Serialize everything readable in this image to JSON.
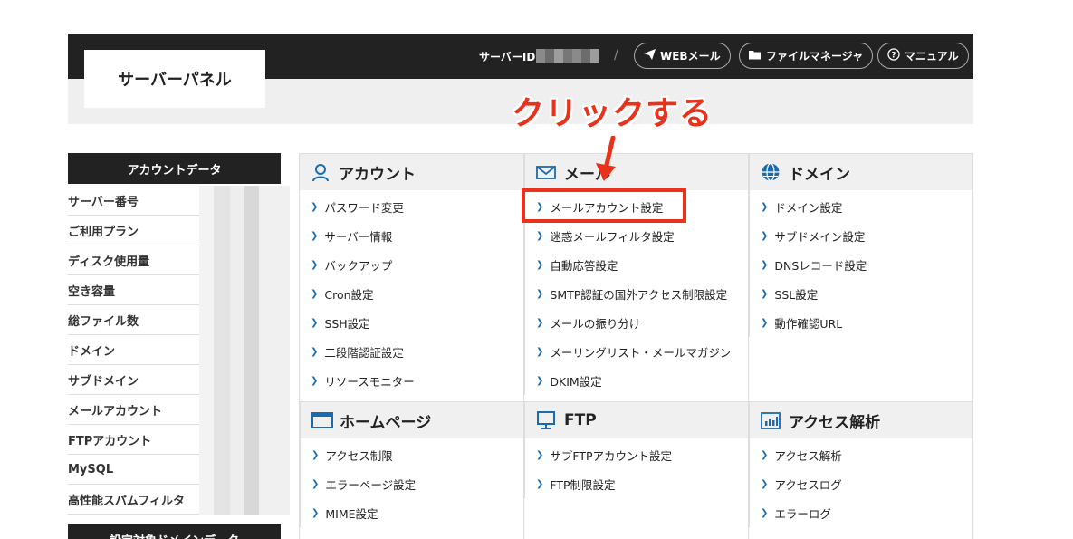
{
  "header": {
    "logo": "サーバーパネル",
    "server_id_label": "サーバーID",
    "separator": "/",
    "buttons": [
      {
        "label": "WEBメール",
        "icon": "paper-plane-icon"
      },
      {
        "label": "ファイルマネージャ",
        "icon": "folder-icon"
      },
      {
        "label": "マニュアル",
        "icon": "help-circle-icon"
      }
    ]
  },
  "annotation": {
    "text": "クリックする",
    "color": "#e8321c"
  },
  "sidebar": {
    "title": "アカウントデータ",
    "items": [
      "サーバー番号",
      "ご利用プラン",
      "ディスク使用量",
      "空き容量",
      "総ファイル数",
      "ドメイン",
      "サブドメイン",
      "メールアカウント",
      "FTPアカウント",
      "MySQL",
      "高性能スパムフィルタ"
    ],
    "title2": "設定対象ドメインデータ"
  },
  "sections": {
    "account": {
      "title": "アカウント",
      "icon": "user-icon",
      "items": [
        "パスワード変更",
        "サーバー情報",
        "バックアップ",
        "Cron設定",
        "SSH設定",
        "二段階認証設定",
        "リソースモニター"
      ]
    },
    "mail": {
      "title": "メール",
      "icon": "envelope-icon",
      "items": [
        "メールアカウント設定",
        "迷惑メールフィルタ設定",
        "自動応答設定",
        "SMTP認証の国外アクセス制限設定",
        "メールの振り分け",
        "メーリングリスト・メールマガジン",
        "DKIM設定"
      ]
    },
    "domain": {
      "title": "ドメイン",
      "icon": "globe-icon",
      "items": [
        "ドメイン設定",
        "サブドメイン設定",
        "DNSレコード設定",
        "SSL設定",
        "動作確認URL"
      ]
    },
    "homepage": {
      "title": "ホームページ",
      "icon": "browser-window-icon",
      "items": [
        "アクセス制限",
        "エラーページ設定",
        "MIME設定"
      ]
    },
    "ftp": {
      "title": "FTP",
      "icon": "monitor-icon",
      "items": [
        "サブFTPアカウント設定",
        "FTP制限設定"
      ]
    },
    "analytics": {
      "title": "アクセス解析",
      "icon": "bar-chart-icon",
      "items": [
        "アクセス解析",
        "アクセスログ",
        "エラーログ"
      ]
    }
  },
  "colors": {
    "header_bg": "#222222",
    "accent_blue": "#1a6bb0",
    "annotation_red": "#e8321c"
  }
}
